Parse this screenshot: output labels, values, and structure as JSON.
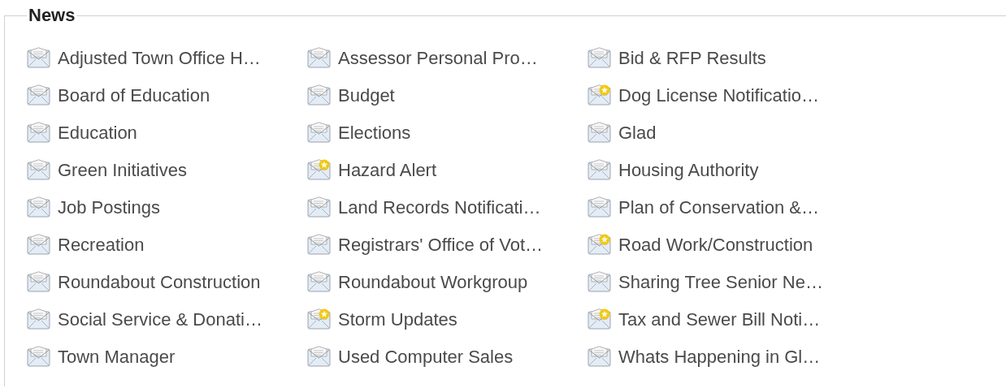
{
  "section": {
    "title": "News"
  },
  "items": [
    {
      "label": "Adjusted Town Office H…",
      "starred": false
    },
    {
      "label": "Assessor Personal Pro…",
      "starred": false
    },
    {
      "label": "Bid & RFP Results",
      "starred": false
    },
    {
      "label": "Board of Education",
      "starred": false
    },
    {
      "label": "Budget",
      "starred": false
    },
    {
      "label": "Dog License Notificatio…",
      "starred": true
    },
    {
      "label": "Education",
      "starred": false
    },
    {
      "label": "Elections",
      "starred": false
    },
    {
      "label": "Glad",
      "starred": false
    },
    {
      "label": "Green Initiatives",
      "starred": false
    },
    {
      "label": "Hazard Alert",
      "starred": true
    },
    {
      "label": "Housing Authority",
      "starred": false
    },
    {
      "label": "Job Postings",
      "starred": false
    },
    {
      "label": "Land Records Notificati…",
      "starred": false
    },
    {
      "label": "Plan of Conservation &…",
      "starred": false
    },
    {
      "label": "Recreation",
      "starred": false
    },
    {
      "label": "Registrars' Office of Vot…",
      "starred": false
    },
    {
      "label": "Road Work/Construction",
      "starred": true
    },
    {
      "label": "Roundabout Construction",
      "starred": false
    },
    {
      "label": "Roundabout Workgroup",
      "starred": false
    },
    {
      "label": "Sharing Tree Senior Ne…",
      "starred": false
    },
    {
      "label": "Social Service & Donati…",
      "starred": false
    },
    {
      "label": "Storm Updates",
      "starred": true
    },
    {
      "label": "Tax and Sewer Bill Noti…",
      "starred": true
    },
    {
      "label": "Town Manager",
      "starred": false
    },
    {
      "label": "Used Computer Sales",
      "starred": false
    },
    {
      "label": "Whats Happening in Gl…",
      "starred": false
    }
  ]
}
